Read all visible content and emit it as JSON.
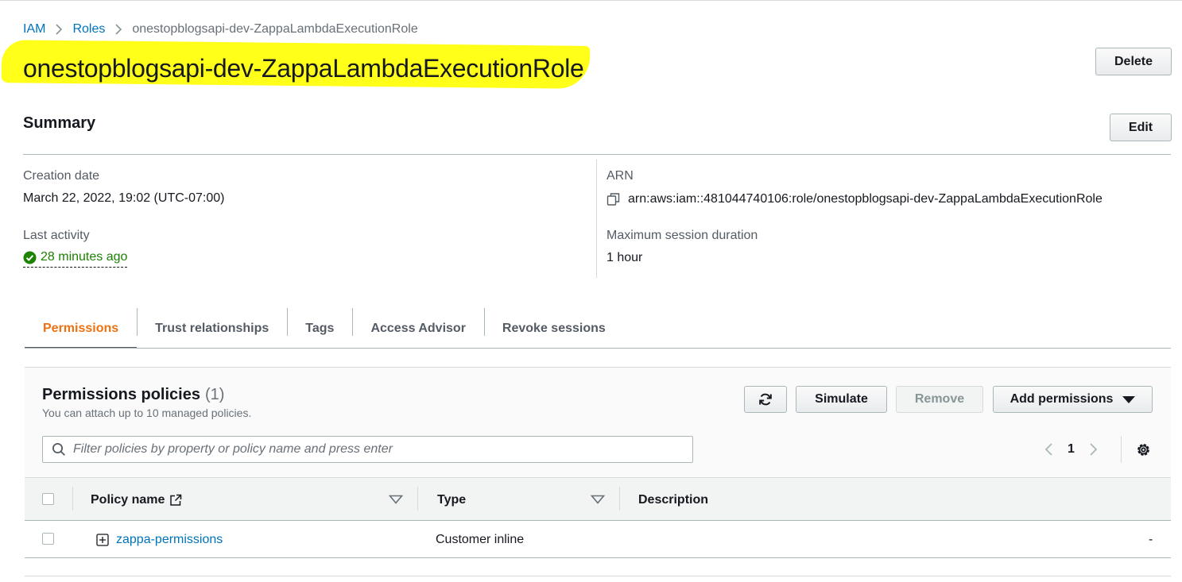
{
  "breadcrumb": {
    "items": [
      "IAM",
      "Roles"
    ],
    "current": "onestopblogsapi-dev-ZappaLambdaExecutionRole"
  },
  "title": "onestopblogsapi-dev-ZappaLambdaExecutionRole",
  "buttons": {
    "delete": "Delete",
    "edit": "Edit"
  },
  "summary": {
    "heading": "Summary",
    "creation_date_label": "Creation date",
    "creation_date_value": "March 22, 2022, 19:02 (UTC-07:00)",
    "last_activity_label": "Last activity",
    "last_activity_value": "28 minutes ago",
    "arn_label": "ARN",
    "arn_value": "arn:aws:iam::481044740106:role/onestopblogsapi-dev-ZappaLambdaExecutionRole",
    "max_session_label": "Maximum session duration",
    "max_session_value": "1 hour"
  },
  "tabs": [
    {
      "label": "Permissions",
      "active": true
    },
    {
      "label": "Trust relationships",
      "active": false
    },
    {
      "label": "Tags",
      "active": false
    },
    {
      "label": "Access Advisor",
      "active": false
    },
    {
      "label": "Revoke sessions",
      "active": false
    }
  ],
  "permissions": {
    "title": "Permissions policies",
    "count": "(1)",
    "subtitle": "You can attach up to 10 managed policies.",
    "simulate_label": "Simulate",
    "remove_label": "Remove",
    "add_permissions_label": "Add permissions",
    "search_placeholder": "Filter policies by property or policy name and press enter",
    "page": "1",
    "columns": {
      "policy_name": "Policy name",
      "type": "Type",
      "description": "Description"
    },
    "rows": [
      {
        "policy_name": "zappa-permissions",
        "type": "Customer inline",
        "description": "-"
      }
    ]
  },
  "colors": {
    "link": "#0073bb",
    "active_tab": "#ec7211",
    "success": "#1d8102",
    "highlight": "#ffff1a"
  },
  "icons": [
    "chevron-right-icon",
    "check-circle-icon",
    "copy-icon",
    "refresh-icon",
    "caret-down-icon",
    "search-icon",
    "chevron-left-icon",
    "gear-icon",
    "external-link-icon",
    "sort-down-icon",
    "expand-plus-icon"
  ]
}
